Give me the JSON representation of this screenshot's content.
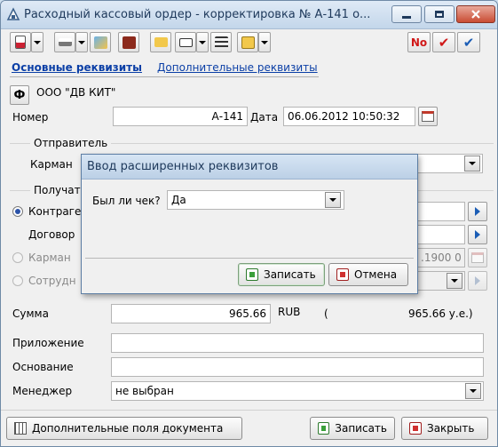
{
  "window": {
    "title": "Расходный кассовый ордер - корректировка № А-141 о..."
  },
  "tabs": {
    "main": "Основные реквизиты",
    "extra": "Дополнительные реквизиты"
  },
  "org": {
    "button": "Ф",
    "name": "ООО \"ДВ КИТ\""
  },
  "doc": {
    "number_label": "Номер",
    "number": "А-141",
    "date_label": "Дата",
    "date": "06.06.2012 10:50:32"
  },
  "sender": {
    "group_title": "Отправитель",
    "cash_label": "Карман"
  },
  "receiver": {
    "group_title": "Получат",
    "contractor_label": "Контраге",
    "contract_label": "Договор",
    "cash_label": "Карман",
    "employee_label": "Сотрудн",
    "cash_date_partial": ".1900 0"
  },
  "sum": {
    "label": "Сумма",
    "value": "965.66",
    "currency": "RUB",
    "paren": "(",
    "ue": "965.66 у.е.)"
  },
  "fields": {
    "attachment_label": "Приложение",
    "basis_label": "Основание",
    "manager_label": "Менеджер",
    "manager_value": "не выбран"
  },
  "footer": {
    "extra_fields": "Дополнительные поля документа",
    "save": "Записать",
    "close": "Закрыть"
  },
  "dialog": {
    "title": "Ввод расширенных реквизитов",
    "check_label": "Был ли чек?",
    "check_value": "Да",
    "save": "Записать",
    "cancel": "Отмена"
  },
  "toolbar": {
    "no_label": "No",
    "icons": [
      "document-icon",
      "print-icon",
      "image-icon",
      "book-icon",
      "folder-icon",
      "card-icon",
      "list-icon",
      "envelope-icon",
      "cancel-icon",
      "check-red-icon",
      "check-blue-icon"
    ]
  },
  "colors": {
    "accent": "#0b3fa6",
    "title_bar": "#c3d6ea",
    "close_button": "#c94c33"
  }
}
